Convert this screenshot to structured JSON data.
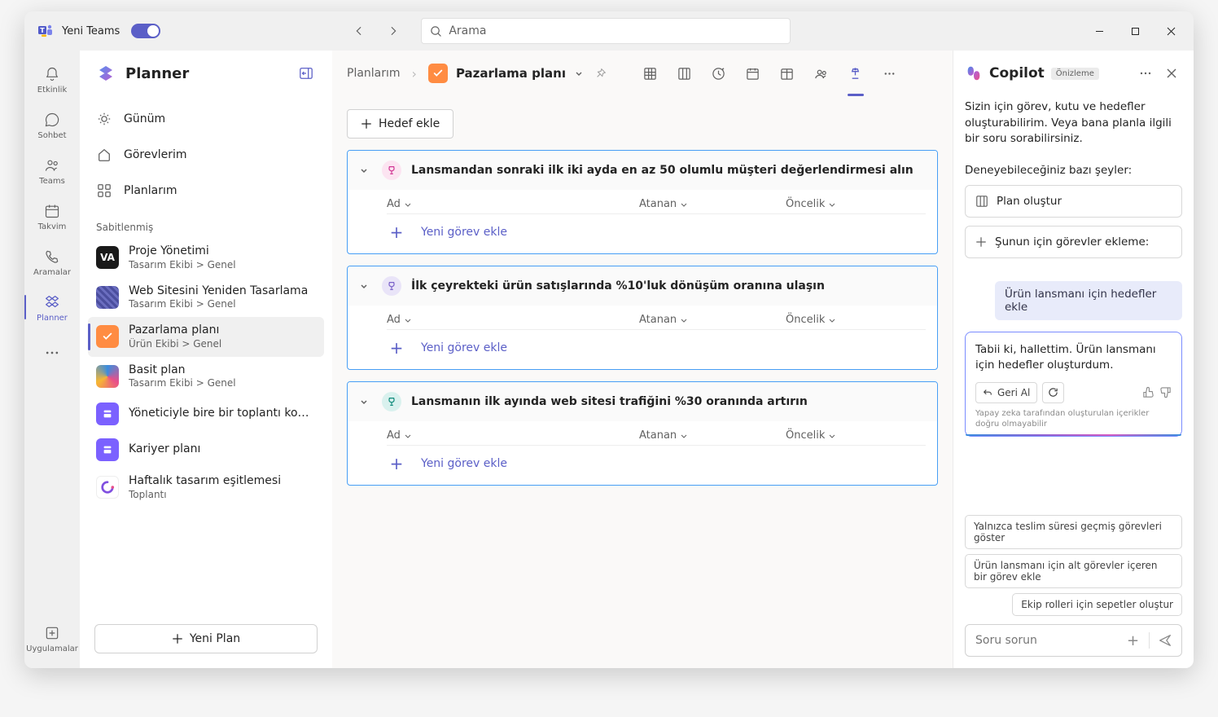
{
  "titlebar": {
    "title": "Yeni Teams",
    "search_placeholder": "Arama"
  },
  "rail": {
    "items": [
      {
        "label": "Etkinlik"
      },
      {
        "label": "Sohbet"
      },
      {
        "label": "Teams"
      },
      {
        "label": "Takvim"
      },
      {
        "label": "Aramalar"
      },
      {
        "label": "Planner"
      }
    ],
    "apps_label": "Uygulamalar"
  },
  "sidebar": {
    "title": "Planner",
    "nav": {
      "day": "Günüm",
      "tasks": "Görevlerim",
      "plans": "Planlarım"
    },
    "pinned_label": "Sabitlenmiş",
    "plans": [
      {
        "name": "Proje Yönetimi",
        "sub": "Tasarım Ekibi > Genel"
      },
      {
        "name": "Web Sitesini Yeniden Tasarlama",
        "sub": "Tasarım Ekibi > Genel"
      },
      {
        "name": "Pazarlama planı",
        "sub": "Ürün Ekibi > Genel"
      },
      {
        "name": "Basit plan",
        "sub": "Tasarım Ekibi > Genel"
      },
      {
        "name": "Yöneticiyle bire bir toplantı konuları",
        "sub": ""
      },
      {
        "name": "Kariyer planı",
        "sub": ""
      },
      {
        "name": "Haftalık tasarım eşitlemesi",
        "sub": "Toplantı"
      }
    ],
    "new_plan": "Yeni Plan"
  },
  "main": {
    "breadcrumb_root": "Planlarım",
    "plan_title": "Pazarlama planı",
    "add_goal": "Hedef ekle",
    "columns": {
      "name": "Ad",
      "assigned": "Atanan",
      "priority": "Öncelik"
    },
    "add_task": "Yeni görev ekle",
    "goals": [
      {
        "title": "Lansmandan sonraki ilk iki ayda en az 50 olumlu müşteri değerlendirmesi alın",
        "color": "pink"
      },
      {
        "title": "İlk çeyrekteki ürün satışlarında %10'luk dönüşüm oranına ulaşın",
        "color": "purple"
      },
      {
        "title": "Lansmanın ilk ayında web sitesi trafiğini %30 oranında artırın",
        "color": "teal"
      }
    ]
  },
  "copilot": {
    "title": "Copilot",
    "badge": "Önizleme",
    "intro": "Sizin için görev, kutu ve hedefler oluşturabilirim. Veya bana planla ilgili bir soru sorabilirsiniz.",
    "try_label": "Deneyebileceğiniz bazı şeyler:",
    "sugg1": "Plan oluştur",
    "sugg2": "Şunun için görevler ekleme:",
    "user_msg": "Ürün lansmanı için hedefler ekle",
    "reply": "Tabii ki, hallettim. Ürün lansmanı için hedefler oluşturdum.",
    "undo": "Geri Al",
    "disclaimer": "Yapay zeka tarafından oluşturulan içerikler doğru olmayabilir",
    "chips": [
      "Yalnızca teslim süresi geçmiş görevleri göster",
      "Ürün lansmanı için alt görevler içeren bir görev ekle",
      "Ekip rolleri için sepetler oluştur"
    ],
    "input_placeholder": "Soru sorun"
  }
}
